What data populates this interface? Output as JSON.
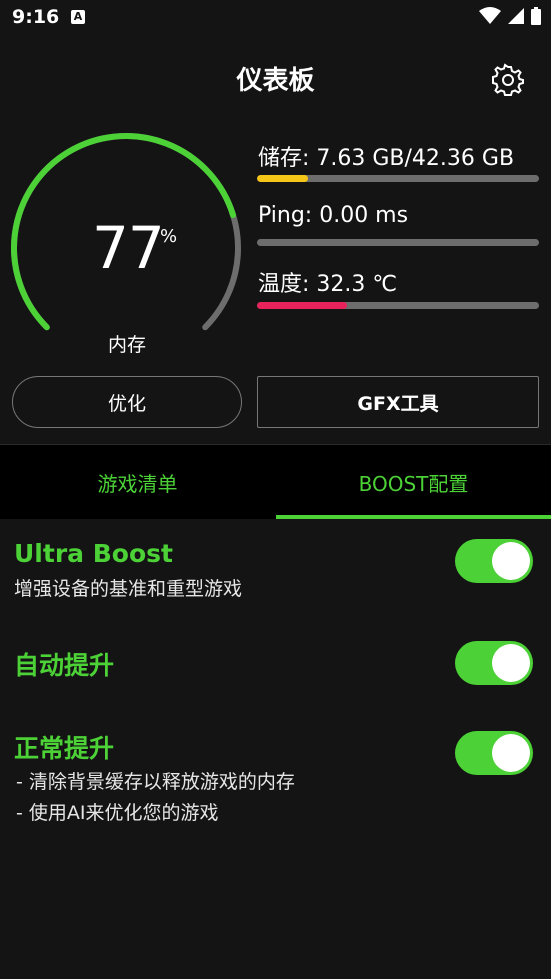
{
  "status_bar": {
    "time": "9:16",
    "notification_icon": "A"
  },
  "header": {
    "title": "仪表板",
    "settings_icon": "gear-icon"
  },
  "gauge": {
    "value": "77",
    "unit": "%",
    "label": "内存",
    "percent": 77,
    "color": "#4cd137",
    "track_color": "#6d6d6d"
  },
  "stats": [
    {
      "label": "储存: 7.63 GB/42.36 GB",
      "fraction": 0.18,
      "color": "#f5c518"
    },
    {
      "label": "Ping: 0.00 ms",
      "fraction": 0.0,
      "color": "#4cd137"
    },
    {
      "label": "温度: 32.3 ℃",
      "fraction": 0.32,
      "color": "#e8225a"
    }
  ],
  "buttons": {
    "optimize": "优化",
    "gfx": "GFX工具"
  },
  "tabs": [
    {
      "label": "游戏清单",
      "active": false
    },
    {
      "label": "BOOST配置",
      "active": true
    }
  ],
  "options": [
    {
      "title": "Ultra Boost",
      "description": "增强设备的基准和重型游戏",
      "enabled": true
    },
    {
      "title": "自动提升",
      "enabled": true
    },
    {
      "title": "正常提升",
      "bullets": [
        "- 清除背景缓存以释放游戏的内存",
        "- 使用AI来优化您的游戏"
      ],
      "enabled": true
    }
  ],
  "colors": {
    "accent": "#4cd137",
    "background": "#141414"
  }
}
